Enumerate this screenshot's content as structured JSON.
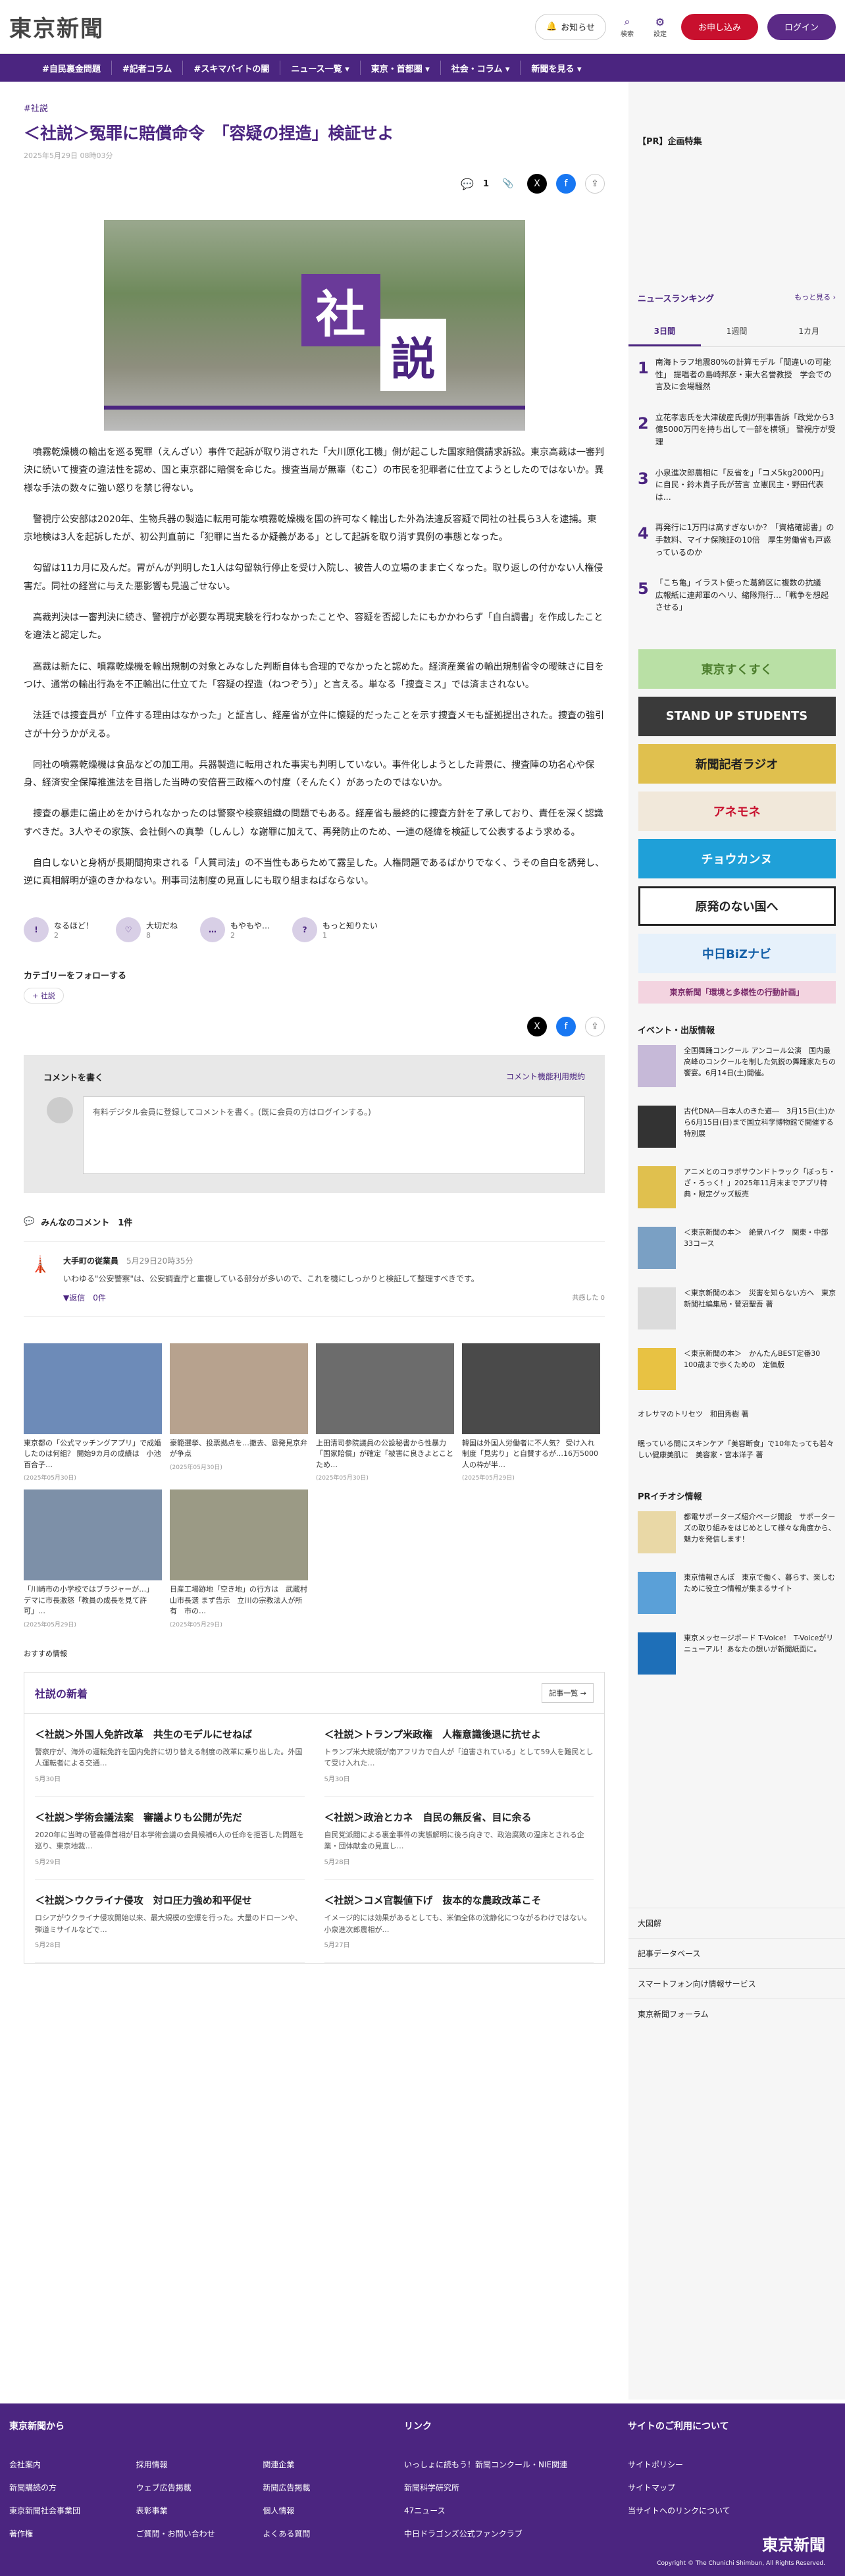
{
  "header": {
    "logo": "東京新聞",
    "notify": "お知らせ",
    "search": "検索",
    "settings": "設定",
    "apply": "お申し込み",
    "login": "ログイン"
  },
  "nav": [
    "#自民裏金問題",
    "#記者コラム",
    "#スキマバイトの闇",
    "ニュース一覧 ▾",
    "東京・首都圏 ▾",
    "社会・コラム ▾",
    "新聞を見る ▾"
  ],
  "article": {
    "tag": "#社説",
    "title": "＜社説＞冤罪に賠償命令　「容疑の捏造」検証せよ",
    "date": "2025年5月29日 08時03分",
    "comment_count": "1",
    "hero": {
      "k1": "社",
      "k2": "説"
    },
    "paras": [
      "噴霧乾燥機の輸出を巡る冤罪（えんざい）事件で起訴が取り消された「大川原化工機」側が起こした国家賠償請求訴訟。東京高裁は一審判決に続いて捜査の違法性を認め、国と東京都に賠償を命じた。捜査当局が無辜（むこ）の市民を犯罪者に仕立てようとしたのではないか。異様な手法の数々に強い怒りを禁じ得ない。",
      "警視庁公安部は2020年、生物兵器の製造に転用可能な噴霧乾燥機を国の許可なく輸出した外為法違反容疑で同社の社長ら3人を逮捕。東京地検は3人を起訴したが、初公判直前に「犯罪に当たるか疑義がある」として起訴を取り消す異例の事態となった。",
      "勾留は11カ月に及んだ。胃がんが判明した1人は勾留執行停止を受け入院し、被告人の立場のまま亡くなった。取り返しの付かない人権侵害だ。同社の経営に与えた悪影響も見過ごせない。",
      "高裁判決は一審判決に続き、警視庁が必要な再現実験を行わなかったことや、容疑を否認したにもかかわらず「自白調書」を作成したことを違法と認定した。",
      "高裁は新たに、噴霧乾燥機を輸出規制の対象とみなした判断自体も合理的でなかったと認めた。経済産業省の輸出規制省令の曖昧さに目をつけ、通常の輸出行為を不正輸出に仕立てた「容疑の捏造（ねつぞう）」と言える。単なる「捜査ミス」では済まされない。",
      "法廷では捜査員が「立件する理由はなかった」と証言し、経産省が立件に懐疑的だったことを示す捜査メモも証拠提出された。捜査の強引さが十分うかがえる。",
      "同社の噴霧乾燥機は食品などの加工用。兵器製造に転用された事実も判明していない。事件化しようとした背景に、捜査陣の功名心や保身、経済安全保障推進法を目指した当時の安倍晋三政権への忖度（そんたく）があったのではないか。",
      "捜査の暴走に歯止めをかけられなかったのは警察や検察組織の問題でもある。経産省も最終的に捜査方針を了承しており、責任を深く認識すべきだ。3人やその家族、会社側への真摯（しんし）な謝罪に加えて、再発防止のため、一連の経緯を検証して公表するよう求める。",
      "自白しないと身柄が長期間拘束される「人質司法」の不当性もあらためて露呈した。人権問題であるばかりでなく、うその自白を誘発し、逆に真相解明が遠のきかねない。刑事司法制度の見直しにも取り組まねばならない。"
    ],
    "reactions": [
      {
        "label": "なるほど！",
        "count": "2",
        "icon": "!"
      },
      {
        "label": "大切だね",
        "count": "8",
        "icon": "♡"
      },
      {
        "label": "もやもや…",
        "count": "2",
        "icon": "…"
      },
      {
        "label": "もっと知りたい",
        "count": "1",
        "icon": "?"
      }
    ],
    "category_follow": "カテゴリーをフォローする",
    "category_chip": "+ 社説"
  },
  "comments": {
    "write": "コメントを書く",
    "terms": "コメント機能利用規約",
    "prompt": "有料デジタル会員に登録してコメントを書く。(既に会員の方はログインする。)",
    "header": "みんなのコメント　1件",
    "item": {
      "user": "大手町の従業員",
      "date": "5月29日20時35分",
      "body": "いわゆる\"公安警察\"は、公安調査庁と重複している部分が多いので、これを機にしっかりと検証して整理すべきです。",
      "reply": "▼返信　0件",
      "good": "共感した 0"
    }
  },
  "related": [
    {
      "cap": "東京都の「公式マッチングアプリ」で成婚したのは何組？ 開始9カ月の成績は　小池百合子…",
      "date": "(2025年05月30日)"
    },
    {
      "cap": "豪範選挙、投票拠点を…撤去、恩発見京弁が争点",
      "date": "(2025年05月30日)"
    },
    {
      "cap": "上田清司参院議員の公設秘書から性暴力「国家賠償」が確定「被害に良きよとことため…",
      "date": "(2025年05月30日)"
    },
    {
      "cap": "韓国は外国人労働者に不人気？ 受け入れ制度「見劣り」と自賛するが…16万5000人の枠が半…",
      "date": "(2025年05月29日)"
    },
    {
      "cap": "「川崎市の小学校ではブラジャーが…」　デマに市長激怒「教員の成長を見て許可」…",
      "date": "(2025年05月29日)"
    },
    {
      "cap": "日産工場跡地「空き地」の行方は　武蔵村山市長選 まず告示　立川の宗教法人が所有　市の…",
      "date": "(2025年05月29日)"
    }
  ],
  "osusume": "おすすめ情報",
  "news": {
    "title": "社説の新着",
    "list": "記事一覧 →",
    "items": [
      {
        "t": "＜社説＞外国人免許改革　共生のモデルにせねば",
        "s": "警察庁が、海外の運転免許を国内免許に切り替える制度の改革に乗り出した。外国人運転者による交通…",
        "d": "5月30日"
      },
      {
        "t": "＜社説＞トランプ米政権　人権意識後退に抗せよ",
        "s": "トランプ米大統領が南アフリカで白人が「迫害されている」として59人を難民として受け入れた…",
        "d": "5月30日"
      },
      {
        "t": "＜社説＞学術会議法案　審議よりも公開が先だ",
        "s": "2020年に当時の菅義偉首相が日本学術会議の会員候補6人の任命を拒否した問題を巡り、東京地裁…",
        "d": "5月29日"
      },
      {
        "t": "＜社説＞政治とカネ　自民の無反省、目に余る",
        "s": "自民党派閥による裏金事件の実態解明に後ろ向きで、政治腐敗の温床とされる企業・団体献金の見直し…",
        "d": "5月28日"
      },
      {
        "t": "＜社説＞ウクライナ侵攻　対ロ圧力強め和平促せ",
        "s": "ロシアがウクライナ侵攻開始以来、最大規模の空爆を行った。大量のドローンや、弾道ミサイルなどで…",
        "d": "5月28日"
      },
      {
        "t": "＜社説＞コメ官製値下げ　抜本的な農政改革こそ",
        "s": "イメージ的には効果があるとしても、米価全体の沈静化につながるわけではない。小泉進次郎農相が…",
        "d": "5月27日"
      }
    ]
  },
  "side": {
    "pr": "【PR】企画特集",
    "ranking_title": "ニュースランキング",
    "more": "もっと見る ›",
    "tabs": [
      "3日間",
      "1週間",
      "1カ月"
    ],
    "ranking": [
      "南海トラフ地震80%の計算モデル「間違いの可能性」 提唱者の島崎邦彦・東大名誉教授　学会での言及に会場騒然",
      "立花孝志氏を大津破産氏側が刑事告訴「政党から3億5000万円を持ち出して一部を横領」 警視庁が受理",
      "小泉進次郎農相に「反省を」「コメ5kg2000円」に自民・鈴木貴子氏が苦言 立憲民主・野田代表は…",
      "再発行に1万円は高すぎないか？「資格確認書」の手数料、マイナ保険証の10倍　厚生労働省も戸惑っているのか",
      "「こち亀」イラスト使った葛飾区に複数の抗議　広報紙に連邦軍のヘリ、縮隊飛行…「戦争を想起させる」"
    ],
    "banners": [
      {
        "txt": "東京すくすく",
        "bg": "#b9e0a5",
        "fg": "#4b7d2c"
      },
      {
        "txt": "STAND UP STUDENTS",
        "bg": "#3a3a3a",
        "fg": "#fff"
      },
      {
        "txt": "新聞記者ラジオ",
        "bg": "#e0c04e",
        "fg": "#222"
      },
      {
        "txt": "アネモネ",
        "bg": "#f1e8da",
        "fg": "#c8102e"
      },
      {
        "txt": "チョウカンヌ",
        "bg": "#1fa0d8",
        "fg": "#fff"
      },
      {
        "txt": "原発のない国へ",
        "bg": "#fff",
        "fg": "#222"
      },
      {
        "txt": "中日BiZナビ",
        "bg": "#e6f1fb",
        "fg": "#1460a8"
      },
      {
        "txt": "東京新聞「環境と多様性の行動計画」",
        "bg": "#f3d4e0",
        "fg": "#7a2a6a"
      }
    ],
    "events_title": "イベント・出版情報",
    "events": [
      "全国舞踊コンクール アンコール公演　国内最高峰のコンクールを制した気鋭の舞踊家たちの饗宴。6月14日(土)開催。",
      "古代DNA―日本人のきた道―　3月15日(土)から6月15日(日)まで国立科学博物館で開催する特別展",
      "アニメとのコラボサウンドトラック「ぼっち・ざ・ろっく！」2025年11月末までアプリ特典・限定グッズ販売",
      "＜東京新聞の本＞　絶景ハイク　関東・中部33コース",
      "＜東京新聞の本＞　災害を知らない方へ　東京新聞社編集局・菅沼聖吾 著",
      "＜東京新聞の本＞　かんたんBEST定番30　100歳まで歩くための　定価版",
      "オレサマのトリセツ　和田秀樹 著",
      "眠っている間にスキンケア「美容断食」で10年たっても若々しい健康美肌に　美容家・宮本洋子 著"
    ],
    "pr2_title": "PRイチオシ情報",
    "pr2": [
      "都電サポーターズ紹介ページ開設　サポーターズの取り組みをはじめとして様々な角度から、魅力を発信します！",
      "東京情報さんぽ　東京で働く、暮らす、楽しむために役立つ情報が集まるサイト",
      "東京メッセージボード T-Voice!　T-Voiceがリニューアル！あなたの想いが新聞紙面に。"
    ],
    "links": [
      "大図解",
      "記事データベース",
      "スマートフォン向け情報サービス",
      "東京新聞フォーラム"
    ]
  },
  "footer": {
    "c1h": "東京新聞から",
    "c1": [
      "会社案内",
      "採用情報",
      "関連企業",
      "新聞購読の方",
      "ウェブ広告掲載",
      "新聞広告掲載",
      "東京新聞社会事業団",
      "表彰事業",
      "個人情報",
      "著作権",
      "ご質問・お問い合わせ",
      "よくある質問"
    ],
    "c2h": "リンク",
    "c2": [
      "いっしょに読もう！新聞コンクール・NIE関連",
      "新聞科学研究所",
      "47ニュース",
      "中日ドラゴンズ公式ファンクラブ"
    ],
    "c3h": "サイトのご利用について",
    "c3": [
      "サイトポリシー",
      "サイトマップ",
      "当サイトへのリンクについて"
    ],
    "copy": "Copyright © The Chunichi Shimbun, All Rights Reserved."
  }
}
